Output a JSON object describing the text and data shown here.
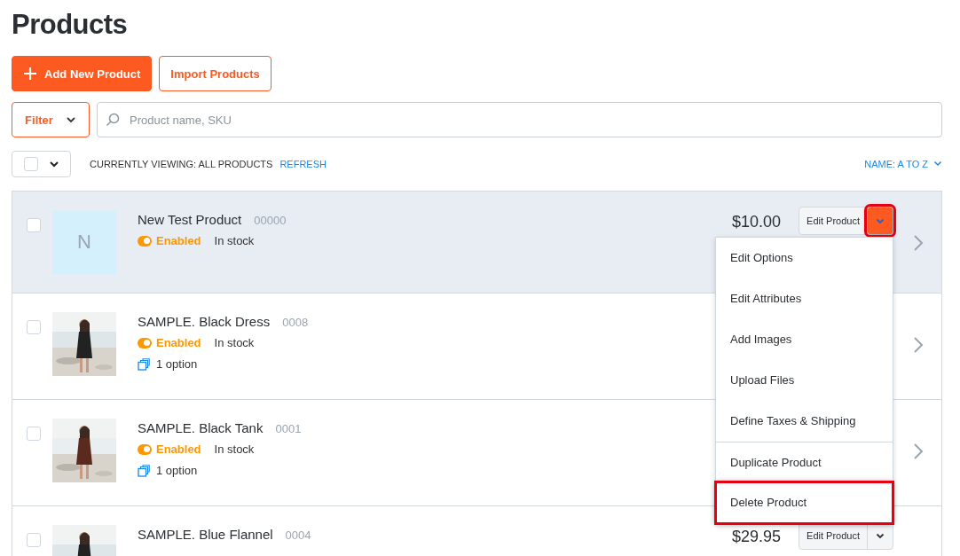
{
  "title": "Products",
  "actions": [
    {
      "label": "Add New Product",
      "kind": "primary"
    },
    {
      "label": "Import Products",
      "kind": "outline"
    }
  ],
  "filter": {
    "label": "Filter"
  },
  "search": {
    "placeholder": "Product name, SKU"
  },
  "toolbar": {
    "select_all_checked": false,
    "viewing": "CURRENTLY VIEWING: ALL PRODUCTS",
    "refresh": "REFRESH",
    "sort": "NAME: A TO Z"
  },
  "products": [
    {
      "name": "New Test Product",
      "sku": "00000",
      "status": "Enabled",
      "enabled": true,
      "stock": "In stock",
      "thumb": {
        "kind": "letter",
        "letter": "N"
      },
      "price": "$10.00",
      "edit": "Edit Product",
      "selected": true,
      "checked": false
    },
    {
      "name": "SAMPLE. Black Dress",
      "sku": "0008",
      "status": "Enabled",
      "enabled": true,
      "stock": "In stock",
      "options": "1 option",
      "selected": false,
      "checked": false
    },
    {
      "name": "SAMPLE. Black Tank",
      "sku": "0001",
      "status": "Enabled",
      "enabled": true,
      "stock": "In stock",
      "options": "1 option",
      "selected": false,
      "checked": false
    },
    {
      "name": "SAMPLE. Blue Flannel",
      "sku": "0004",
      "price": "$29.95",
      "edit": "Edit Product",
      "selected": false,
      "checked": false
    }
  ],
  "menu": {
    "toggle_highlighted": true,
    "items": [
      {
        "label": "Edit Options",
        "divider_before": false,
        "highlighted": false
      },
      {
        "label": "Edit Attributes",
        "divider_before": false,
        "highlighted": false
      },
      {
        "label": "Add Images",
        "divider_before": false,
        "highlighted": false
      },
      {
        "label": "Upload Files",
        "divider_before": false,
        "highlighted": false
      },
      {
        "label": "Define Taxes & Shipping",
        "divider_before": false,
        "highlighted": false
      },
      {
        "label": "Duplicate Product",
        "divider_before": true,
        "highlighted": false
      },
      {
        "label": "Delete Product",
        "divider_before": false,
        "highlighted": true
      }
    ]
  }
}
